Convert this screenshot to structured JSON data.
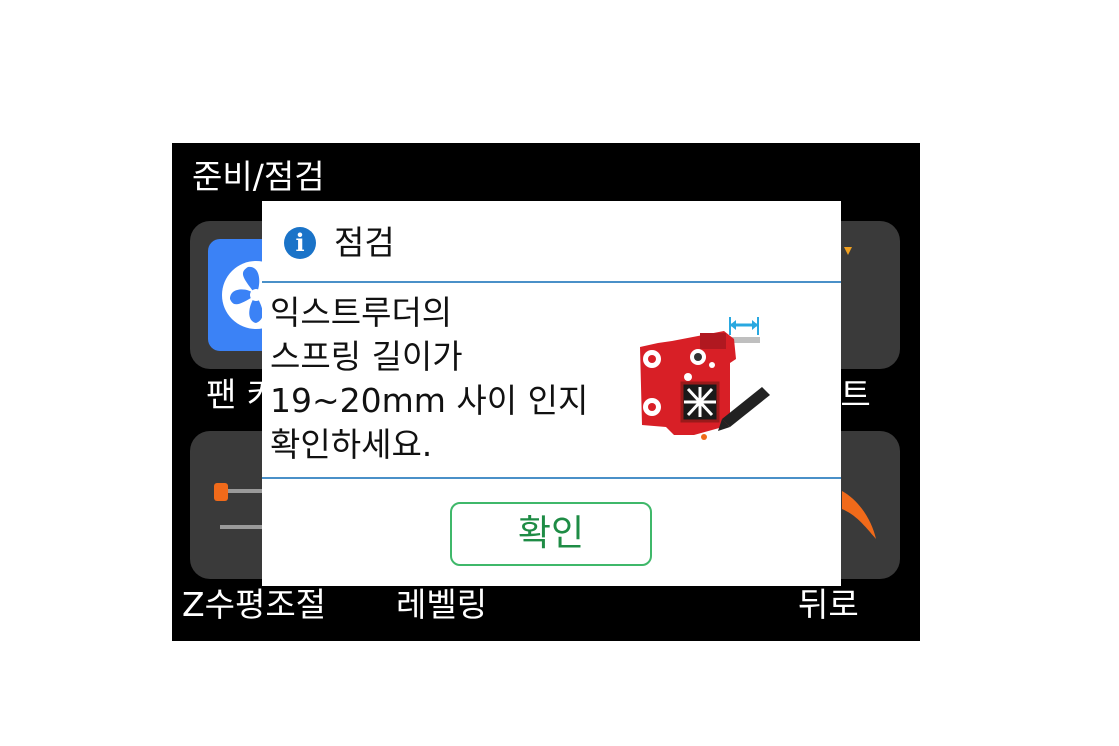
{
  "screen": {
    "title": "준비/점검"
  },
  "tiles": {
    "fan": {
      "label": "팬 켜"
    },
    "top_right": {
      "label": "센트"
    },
    "z_level": {
      "label": "Z수평조절"
    },
    "leveling": {
      "label": "레벨링"
    },
    "back": {
      "label": "뒤로"
    }
  },
  "dialog": {
    "title": "점검",
    "icon": "info-icon",
    "message": "익스트루더의\n스프링 길이가\n19~20mm 사이 인지\n확인하세요.",
    "confirm_label": "확인"
  },
  "colors": {
    "screen_bg": "#000000",
    "tile_bg": "#3a3a3a",
    "fan_tile_bg": "#3b82f6",
    "info_icon": "#1a73c8",
    "divider": "#4a90c8",
    "confirm_border": "#3fb86a",
    "confirm_text": "#1e8c45",
    "extruder_red": "#d81f26",
    "arrow_blue": "#29a8e0",
    "orange_accent": "#f06a1a"
  }
}
